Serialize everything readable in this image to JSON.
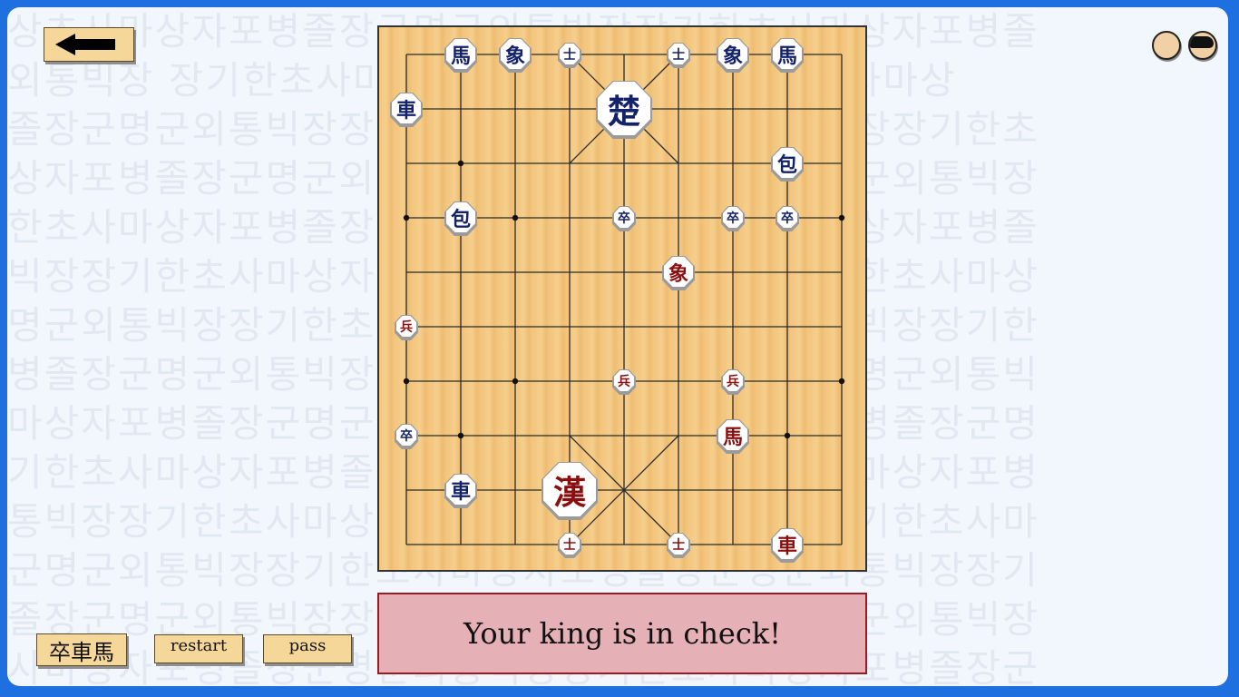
{
  "background_text": [
    "상초사마상자포병졸장군명군외통빅장장기한초사마상자포병졸",
    "외통빅장 장기한초사마상자포병졸장군명 장기한초사마상",
    "졸장군명군외통빅장장기한초사마상자포명군외통빅장장기한초",
    "상자포병졸장군명군외통빅장장기한초사마상자포명군외통빅장",
    "한초사마상자포병졸장군명군외통빅장장기한초사마상자포병졸",
    "빅장장기한초사마상자포병졸장군명군외통빅장장기한초사마상",
    "명군외통빅장장기한초사마상자포병졸장군명군외통빅장장기한",
    "병졸장군명군외통빅장장기한초사마상자포병졸장군명군외통빅",
    "마상자포병졸장군명군외통빅장장기한초사마상자포병졸장군명",
    "기한초사마상자포병졸장군명군외통빅장장기한초사마상자포병",
    "통빅장장기한초사마상자포병졸장군명군외통빅장장기한초사마",
    "군명군외통빅장장기한초사마상자포병졸장군명군외통빅장장기",
    "졸장군명군외통빅장장기한초사마상자포병졸장군명군외통빅장",
    "사마상자포병졸장군명군외통빅장장기한초사마상자포병졸장군"
  ],
  "header": {
    "back_icon": "arrow-left-icon",
    "light_icon": "light-piece-icon",
    "dark_icon": "dark-piece-icon"
  },
  "board": {
    "files": 9,
    "ranks": 10,
    "colors": {
      "blue": "#14226a",
      "red": "#8a1010",
      "line": "#2a2a2a"
    },
    "pieces": [
      {
        "char": "馬",
        "side": "blue",
        "file": 1,
        "rank": 0
      },
      {
        "char": "象",
        "side": "blue",
        "file": 2,
        "rank": 0
      },
      {
        "char": "士",
        "side": "blue",
        "file": 3,
        "rank": 0
      },
      {
        "char": "士",
        "side": "blue",
        "file": 5,
        "rank": 0
      },
      {
        "char": "象",
        "side": "blue",
        "file": 6,
        "rank": 0
      },
      {
        "char": "馬",
        "side": "blue",
        "file": 7,
        "rank": 0
      },
      {
        "char": "車",
        "side": "blue",
        "file": 0,
        "rank": 1
      },
      {
        "char": "楚",
        "side": "blue",
        "file": 4,
        "rank": 1
      },
      {
        "char": "包",
        "side": "blue",
        "file": 7,
        "rank": 2
      },
      {
        "char": "包",
        "side": "blue",
        "file": 1,
        "rank": 3
      },
      {
        "char": "卒",
        "side": "blue",
        "file": 4,
        "rank": 3
      },
      {
        "char": "卒",
        "side": "blue",
        "file": 6,
        "rank": 3
      },
      {
        "char": "卒",
        "side": "blue",
        "file": 7,
        "rank": 3
      },
      {
        "char": "象",
        "side": "red",
        "file": 5,
        "rank": 4
      },
      {
        "char": "兵",
        "side": "red",
        "file": 0,
        "rank": 5
      },
      {
        "char": "兵",
        "side": "red",
        "file": 4,
        "rank": 6
      },
      {
        "char": "兵",
        "side": "red",
        "file": 6,
        "rank": 6
      },
      {
        "char": "卒",
        "side": "blue",
        "file": 0,
        "rank": 7
      },
      {
        "char": "馬",
        "side": "red",
        "file": 6,
        "rank": 7
      },
      {
        "char": "車",
        "side": "blue",
        "file": 1,
        "rank": 8
      },
      {
        "char": "漢",
        "side": "red",
        "file": 3,
        "rank": 8
      },
      {
        "char": "士",
        "side": "red",
        "file": 3,
        "rank": 9
      },
      {
        "char": "士",
        "side": "red",
        "file": 5,
        "rank": 9
      },
      {
        "char": "車",
        "side": "red",
        "file": 7,
        "rank": 9
      }
    ]
  },
  "status": {
    "message": "Your king is in check!"
  },
  "controls": {
    "mode_label": "卒車馬",
    "restart_label": "restart",
    "pass_label": "pass"
  }
}
